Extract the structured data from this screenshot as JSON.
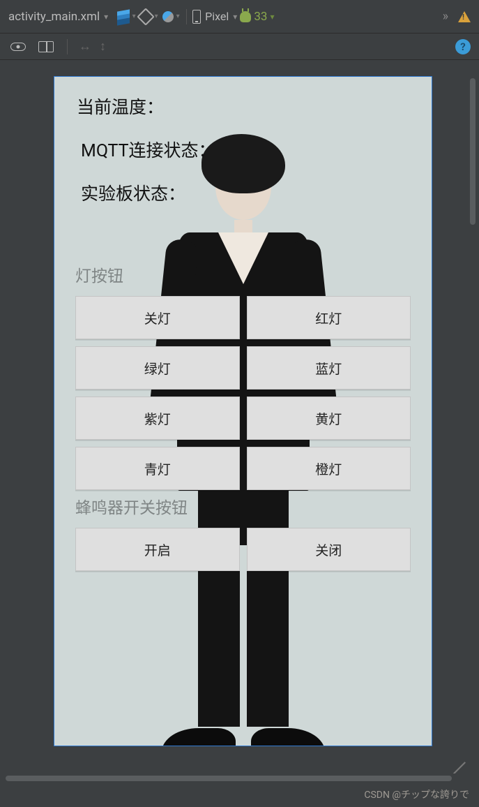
{
  "toolbar": {
    "file_name": "activity_main.xml",
    "device_label": "Pixel",
    "api_label": "33"
  },
  "app": {
    "temp_label": "当前温度：",
    "mqtt_label": "MQTT连接状态：",
    "board_label": "实验板状态：",
    "light_section_label": "灯按钮",
    "buzzer_section_label": "蜂鸣器开关按钮",
    "light_buttons": [
      "关灯",
      "红灯",
      "绿灯",
      "蓝灯",
      "紫灯",
      "黄灯",
      "青灯",
      "橙灯"
    ],
    "buzzer_buttons": [
      "开启",
      "关闭"
    ]
  },
  "watermark": "CSDN @チップな誇りで"
}
